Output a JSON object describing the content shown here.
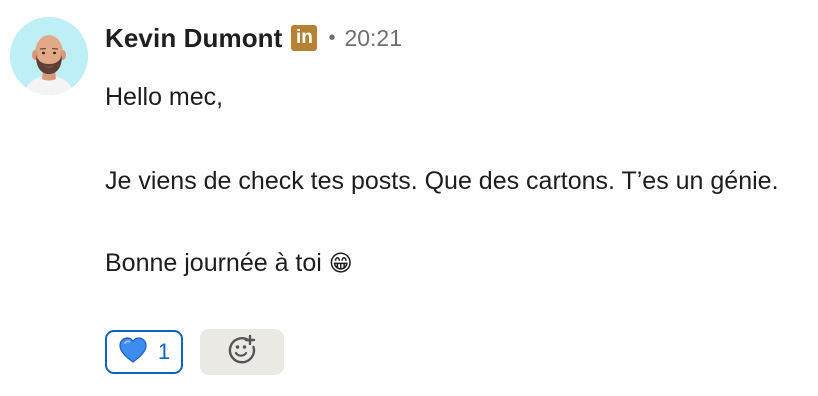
{
  "author": {
    "name": "Kevin Dumont",
    "badge_text": "in",
    "badge_color": "#b48232",
    "separator": "•",
    "time": "20:21",
    "avatar_icon": "profile-photo"
  },
  "message": {
    "lines": [
      "Hello mec,",
      "Je viens de check tes posts. Que des cartons. T’es un génie.",
      "Bonne journée à toi"
    ],
    "end_emoji": "😁"
  },
  "reactions": [
    {
      "emoji": "💙",
      "count": "1",
      "icon": "blue-heart-icon",
      "accent": "#0a66c2"
    }
  ],
  "add_reaction": {
    "icon": "add-reaction-icon"
  }
}
